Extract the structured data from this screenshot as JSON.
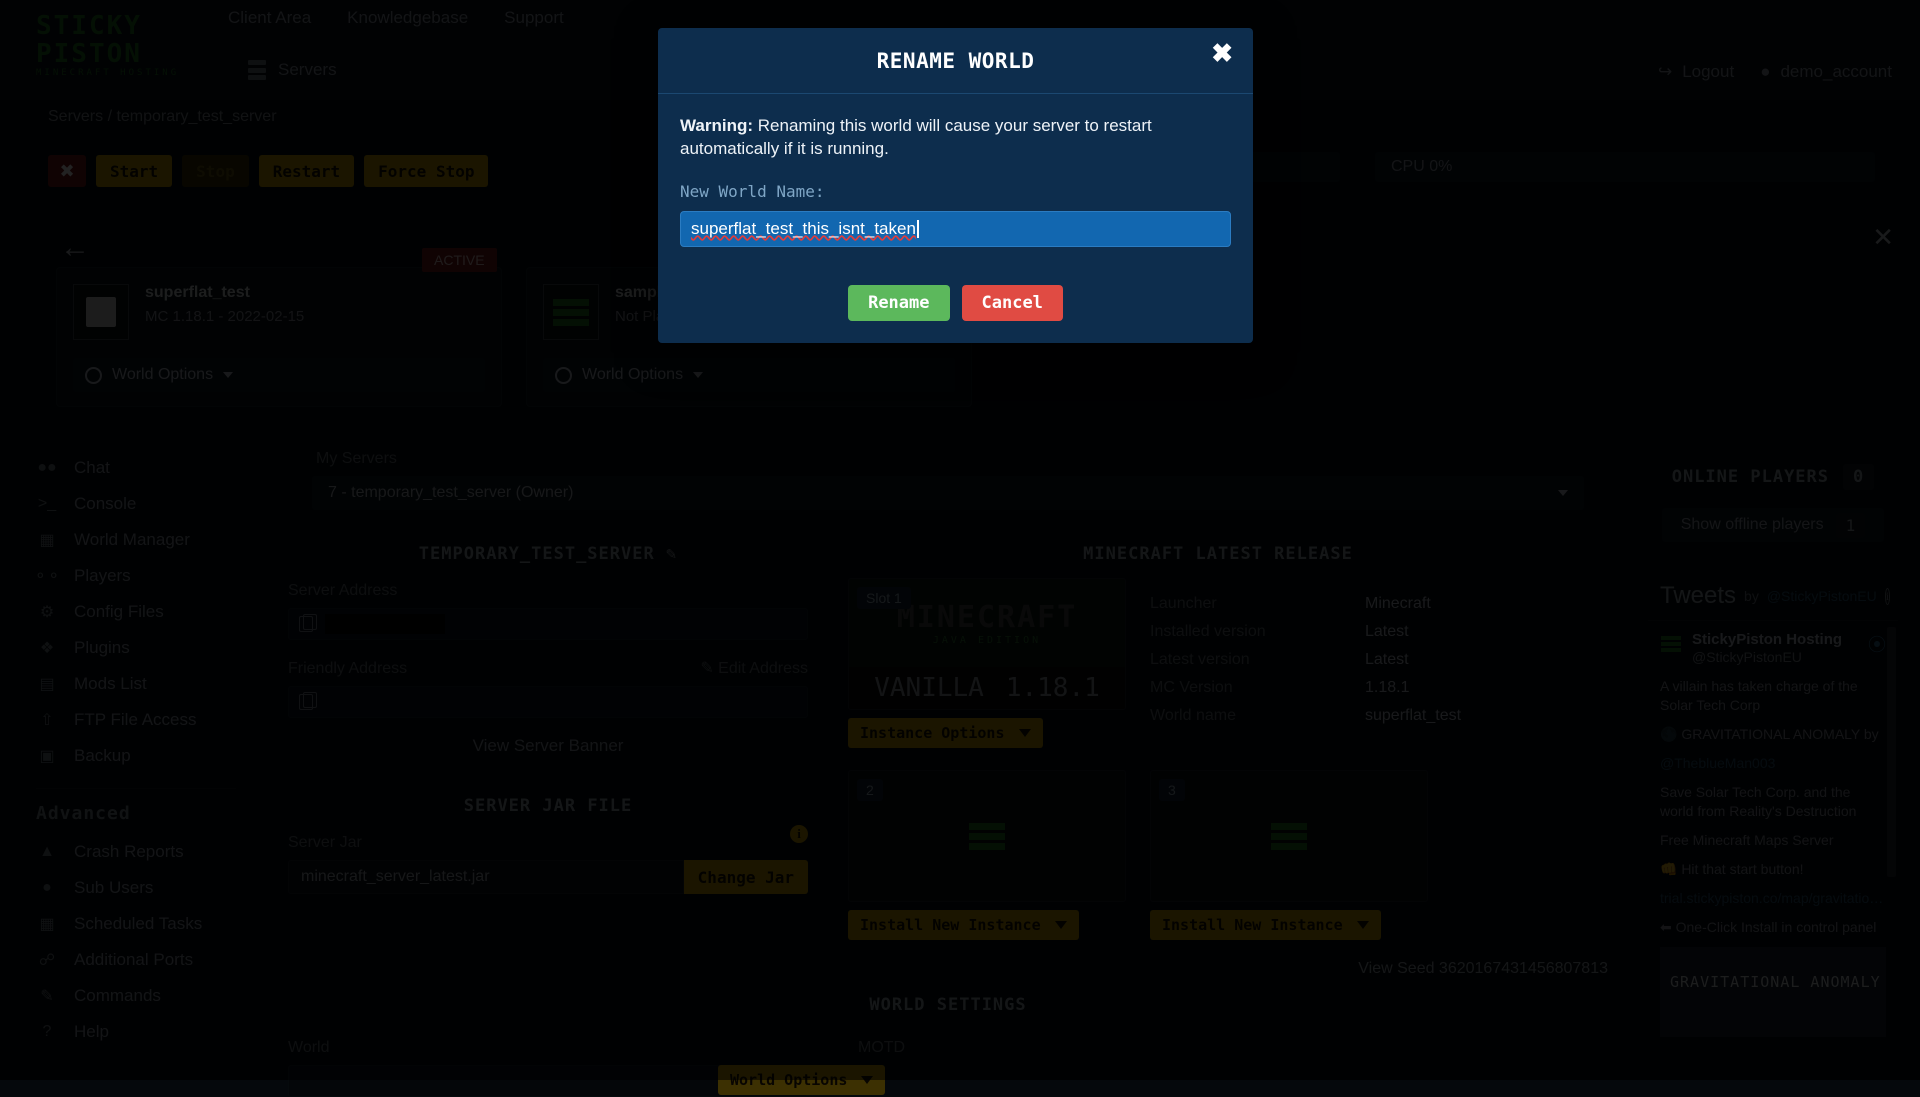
{
  "header": {
    "logo_line1": "STICKY",
    "logo_line2": "PISTON",
    "logo_tagline": "MINECRAFT HOSTING",
    "nav": [
      {
        "label": "Client Area"
      },
      {
        "label": "Knowledgebase"
      },
      {
        "label": "Support"
      }
    ],
    "servers_label": "Servers",
    "logout_label": "Logout",
    "account_label": "demo_account"
  },
  "breadcrumb": "Servers / temporary_test_server",
  "power": {
    "stop_x": "✖",
    "start": "Start",
    "stop": "Stop",
    "restart": "Restart",
    "force_stop": "Force Stop"
  },
  "status_pills": {
    "ram": "",
    "cpu": "CPU 0%"
  },
  "worlds": {
    "back_arrow": "←",
    "close": "✕",
    "active_badge": "ACTIVE",
    "cards": [
      {
        "name": "superflat_test",
        "sub": "MC 1.18.1 - 2022-02-15",
        "options_label": "World Options",
        "thumb": "minecraft-head-thumb"
      },
      {
        "name": "sample_w",
        "sub": "Not Played",
        "options_label": "World Options",
        "thumb": "stickypiston-logo-thumb"
      }
    ]
  },
  "sidebar": {
    "items": [
      {
        "label": "Chat",
        "icon": "chat-icon",
        "glyph": "💬"
      },
      {
        "label": "Console",
        "icon": "console-icon",
        "glyph": ">_"
      },
      {
        "label": "World Manager",
        "icon": "world-manager-icon",
        "glyph": "▤"
      },
      {
        "label": "Players",
        "icon": "players-icon",
        "glyph": "∞"
      },
      {
        "label": "Config Files",
        "icon": "config-files-icon",
        "glyph": "⚙"
      },
      {
        "label": "Plugins",
        "icon": "plugins-icon",
        "glyph": "❖"
      },
      {
        "label": "Mods List",
        "icon": "mods-list-icon",
        "glyph": "☰"
      },
      {
        "label": "FTP File Access",
        "icon": "ftp-file-access-icon",
        "glyph": "⬆"
      },
      {
        "label": "Backup",
        "icon": "backup-icon",
        "glyph": "💾"
      }
    ],
    "advanced_heading": "Advanced",
    "advanced_items": [
      {
        "label": "Crash Reports",
        "icon": "warning-icon",
        "glyph": "⚠"
      },
      {
        "label": "Sub Users",
        "icon": "user-icon",
        "glyph": "👤"
      },
      {
        "label": "Scheduled Tasks",
        "icon": "calendar-icon",
        "glyph": "📅"
      },
      {
        "label": "Additional Ports",
        "icon": "plug-icon",
        "glyph": "⚡"
      },
      {
        "label": "Commands",
        "icon": "edit-icon",
        "glyph": "✎"
      },
      {
        "label": "Help",
        "icon": "help-icon",
        "glyph": "?"
      }
    ]
  },
  "main": {
    "my_servers_label": "My Servers",
    "server_select_value": "7 - temporary_test_server (Owner)",
    "server_panel_title": "TEMPORARY_TEST_SERVER",
    "server_address_label": "Server Address",
    "server_address_value": "",
    "friendly_address_label": "Friendly Address",
    "friendly_address_value": "",
    "edit_address_label": "Edit Address",
    "view_banner_label": "View Server Banner",
    "jar_panel_title": "SERVER JAR FILE",
    "server_jar_label": "Server Jar",
    "server_jar_value": "minecraft_server_latest.jar",
    "change_jar_label": "Change Jar",
    "info_glyph": "i"
  },
  "release": {
    "title": "MINECRAFT LATEST RELEASE",
    "rows": [
      {
        "key": "Launcher",
        "value": "Minecraft"
      },
      {
        "key": "Installed version",
        "value": "Latest"
      },
      {
        "key": "Latest version",
        "value": "Latest"
      },
      {
        "key": "MC Version",
        "value": "1.18.1"
      },
      {
        "key": "World name",
        "value": "superflat_test"
      }
    ]
  },
  "instances": {
    "slot1_badge": "Slot 1",
    "slot1_art_word": "MINECRAFT",
    "slot1_art_sub": "JAVA EDITION",
    "slot1_bar_left": "VANILLA",
    "slot1_bar_right": "1.18.1",
    "slot1_button": "Instance Options",
    "slot2_badge": "2",
    "slot2_button": "Install New Instance",
    "slot3_badge": "3",
    "slot3_button": "Install New Instance"
  },
  "world_settings": {
    "title": "WORLD SETTINGS",
    "world_label": "World",
    "motd_label": "MOTD",
    "world_options_label": "World Options",
    "seed_label": "View Seed 3620167431456807813"
  },
  "online_players": {
    "title": "ONLINE PLAYERS",
    "count": "0",
    "show_offline_label": "Show offline players",
    "offline_count": "1"
  },
  "tweets": {
    "heading": "Tweets",
    "by": "by",
    "handle": "@StickyPistonEU",
    "info_glyph": "i",
    "account_name": "StickyPiston Hosting",
    "account_handle": "@StickyPistonEU",
    "bird_glyph": "🐦",
    "lines": [
      "A villain has taken charge of the Solar Tech Corp",
      "🌑 GRAVITATIONAL ANOMALY by",
      "@TheblueMan003",
      "Save Solar Tech Corp. and the world from Reality's Destruction",
      "Free Minecraft Maps Server",
      "👊 Hit that start button!",
      "trial.stickypiston.co/map/gravitatio…",
      "⬅ One-Click Install in control panel"
    ],
    "image_caption": "GRAVITATIONAL ANOMALY"
  },
  "modal": {
    "title": "RENAME WORLD",
    "close_glyph": "✖",
    "warning_bold": "Warning:",
    "warning_text": " Renaming this world will cause your server to restart automatically if it is running.",
    "field_label": "New World Name:",
    "field_value": "superflat_test_this_isnt_taken",
    "confirm_label": "Rename",
    "cancel_label": "Cancel",
    "accent_header_bg": "#0d2d4d",
    "input_bg": "#1267b0",
    "confirm_color": "#5cb85c",
    "cancel_color": "#e04b43"
  }
}
